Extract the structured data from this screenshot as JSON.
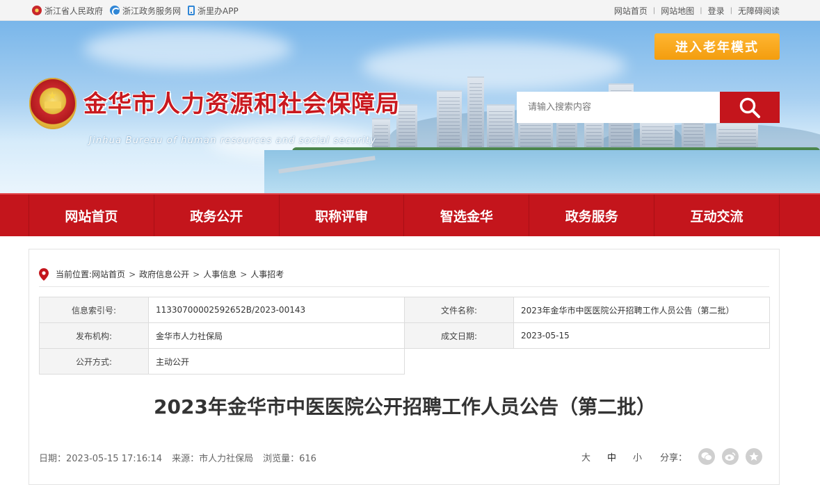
{
  "topbar": {
    "links_left": [
      "浙江省人民政府",
      "浙江政务服务网",
      "浙里办APP"
    ],
    "links_right": [
      "网站首页",
      "网站地图",
      "登录",
      "无障碍阅读"
    ]
  },
  "header": {
    "org_cn": "金华市人力资源和社会保障局",
    "org_en": "Jinhua Bureau of human resources and social security",
    "elder_mode": "进入老年模式",
    "search_placeholder": "请输入搜索内容"
  },
  "nav": [
    "网站首页",
    "政务公开",
    "职称评审",
    "智选金华",
    "政务服务",
    "互动交流"
  ],
  "breadcrumb": {
    "label": "当前位置:",
    "items": [
      "网站首页",
      "政府信息公开",
      "人事信息",
      "人事招考"
    ]
  },
  "meta": {
    "index_label": "信息索引号:",
    "index_value": "11330700002592652B/2023-00143",
    "filename_label": "文件名称:",
    "filename_value": "2023年金华市中医医院公开招聘工作人员公告（第二批）",
    "publisher_label": "发布机构:",
    "publisher_value": "金华市人力社保局",
    "date_label": "成文日期:",
    "date_value": "2023-05-15",
    "mode_label": "公开方式:",
    "mode_value": "主动公开"
  },
  "article": {
    "title": "2023年金华市中医医院公开招聘工作人员公告（第二批）",
    "date": "日期：2023-05-15 17:16:14",
    "source": "来源：市人力社保局",
    "views": "浏览量：616"
  },
  "tools": {
    "size_large": "大",
    "size_mid": "中",
    "size_small": "小",
    "share_label": "分享：",
    "share_icons": [
      "wechat-icon",
      "weibo-icon",
      "favorite-icon"
    ]
  },
  "colors": {
    "brand_red": "#c4151c",
    "accent_orange": "#f39d0e"
  }
}
